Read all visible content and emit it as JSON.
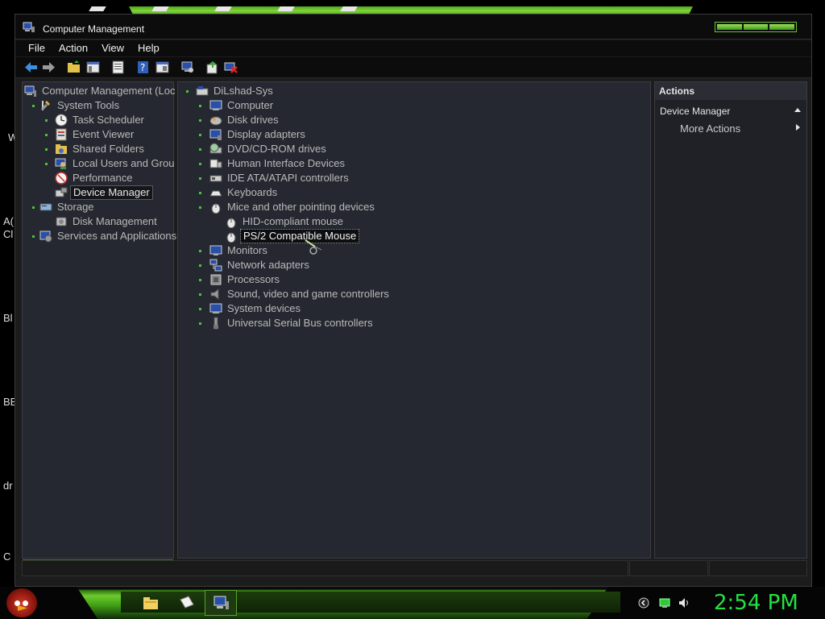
{
  "window": {
    "title": "Computer Management"
  },
  "menu": [
    "File",
    "Action",
    "View",
    "Help"
  ],
  "toolbar_icons": [
    "back-arrow-icon",
    "forward-arrow-icon",
    "up-folder-icon",
    "show-hide-tree-icon",
    "properties-icon",
    "help-icon",
    "view-icon",
    "scan-hardware-icon",
    "update-driver-icon",
    "uninstall-icon"
  ],
  "left_tree": {
    "root": "Computer Management (Loc",
    "system_tools": "System Tools",
    "task_scheduler": "Task Scheduler",
    "event_viewer": "Event Viewer",
    "shared_folders": "Shared Folders",
    "local_users": "Local Users and Grou",
    "performance": "Performance",
    "device_manager": "Device Manager",
    "storage": "Storage",
    "disk_management": "Disk Management",
    "services": "Services and Applications"
  },
  "device_tree": {
    "root": "DiLshad-Sys",
    "categories": [
      "Computer",
      "Disk drives",
      "Display adapters",
      "DVD/CD-ROM drives",
      "Human Interface Devices",
      "IDE ATA/ATAPI controllers",
      "Keyboards",
      "Mice and other pointing devices"
    ],
    "mice_children": [
      "HID-compliant mouse",
      "PS/2 Compatible Mouse"
    ],
    "categories_after": [
      "Monitors",
      "Network adapters",
      "Processors",
      "Sound, video and game controllers",
      "System devices",
      "Universal Serial Bus controllers"
    ]
  },
  "actions": {
    "header": "Actions",
    "section": "Device Manager",
    "more": "More Actions"
  },
  "desktop_labels": [
    "W",
    "A(",
    "Cl",
    "Bl",
    "BE",
    "dr",
    "C"
  ],
  "taskbar": {
    "clock": "2:54 PM"
  },
  "colors": {
    "accent_green": "#4cc23a",
    "clock_green": "#26e041",
    "pane_bg": "#252830"
  }
}
